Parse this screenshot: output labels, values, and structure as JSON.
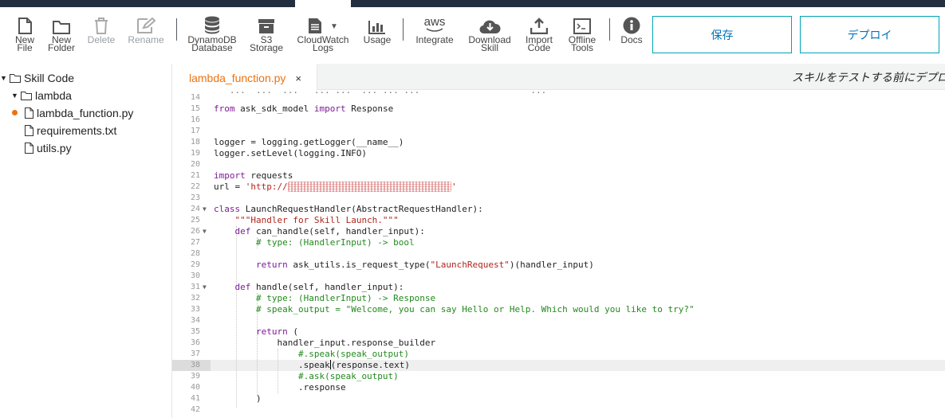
{
  "toolbar": {
    "new_file": "New\nFile",
    "new_folder": "New\nFolder",
    "delete": "Delete",
    "rename": "Rename",
    "dynamodb": "DynamoDB\nDatabase",
    "s3": "S3\nStorage",
    "cloudwatch": "CloudWatch\nLogs",
    "usage": "Usage",
    "integrate": "Integrate",
    "aws_logo": "aws",
    "download": "Download\nSkill",
    "import": "Import\nCode",
    "offline": "Offline\nTools",
    "docs": "Docs",
    "save_label": "保存",
    "deploy_label": "デプロイ"
  },
  "sidebar": {
    "items": [
      {
        "label": "Skill Code"
      },
      {
        "label": "lambda"
      },
      {
        "label": "lambda_function.py"
      },
      {
        "label": "requirements.txt"
      },
      {
        "label": "utils.py"
      }
    ]
  },
  "tabs": [
    {
      "label": "lambda_function.py",
      "close": "×"
    }
  ],
  "notice": "スキルをテストする前にデプロ",
  "editor": {
    "line_numbers": [
      "14",
      "15",
      "16",
      "17",
      "18",
      "19",
      "20",
      "21",
      "22",
      "23",
      "24",
      "25",
      "26",
      "27",
      "28",
      "29",
      "30",
      "31",
      "32",
      "33",
      "34",
      "35",
      "36",
      "37",
      "38",
      "39",
      "40",
      "41",
      "42"
    ],
    "cursor_line": "38"
  },
  "colors": {
    "accent_orange": "#ec7211",
    "button_border": "#00a4b4",
    "button_text": "#0073bb",
    "topbar": "#232f3e"
  }
}
